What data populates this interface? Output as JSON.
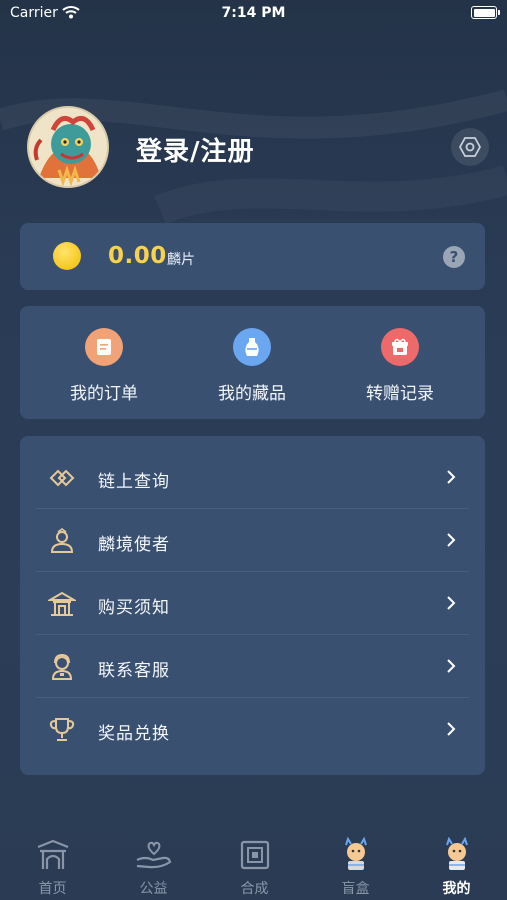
{
  "status_bar": {
    "carrier": "Carrier",
    "time": "7:14 PM"
  },
  "profile": {
    "login_label": "登录/注册"
  },
  "balance": {
    "amount": "0.00",
    "unit": "麟片",
    "help_symbol": "?"
  },
  "quick_actions": [
    {
      "label": "我的订单",
      "icon": "order-icon",
      "color": "#f2a277"
    },
    {
      "label": "我的藏品",
      "icon": "vase-icon",
      "color": "#6aa7f0"
    },
    {
      "label": "转赠记录",
      "icon": "gift-icon",
      "color": "#ee6a6a"
    }
  ],
  "menu": [
    {
      "label": "链上查询",
      "icon": "chain-link-icon"
    },
    {
      "label": "麟境使者",
      "icon": "ambassador-icon"
    },
    {
      "label": "购买须知",
      "icon": "pavilion-icon"
    },
    {
      "label": "联系客服",
      "icon": "customer-service-icon"
    },
    {
      "label": "奖品兑换",
      "icon": "trophy-icon"
    }
  ],
  "tabs": [
    {
      "label": "首页",
      "icon": "home-gate-icon",
      "active": false
    },
    {
      "label": "公益",
      "icon": "charity-hand-icon",
      "active": false
    },
    {
      "label": "合成",
      "icon": "synthesis-icon",
      "active": false
    },
    {
      "label": "盲盒",
      "icon": "blind-box-mascot-icon",
      "active": false
    },
    {
      "label": "我的",
      "icon": "profile-mascot-icon",
      "active": true
    }
  ],
  "colors": {
    "accent_gold": "#f7d24a",
    "card_bg": "#3a5071",
    "page_bg": "#2a3b55"
  }
}
